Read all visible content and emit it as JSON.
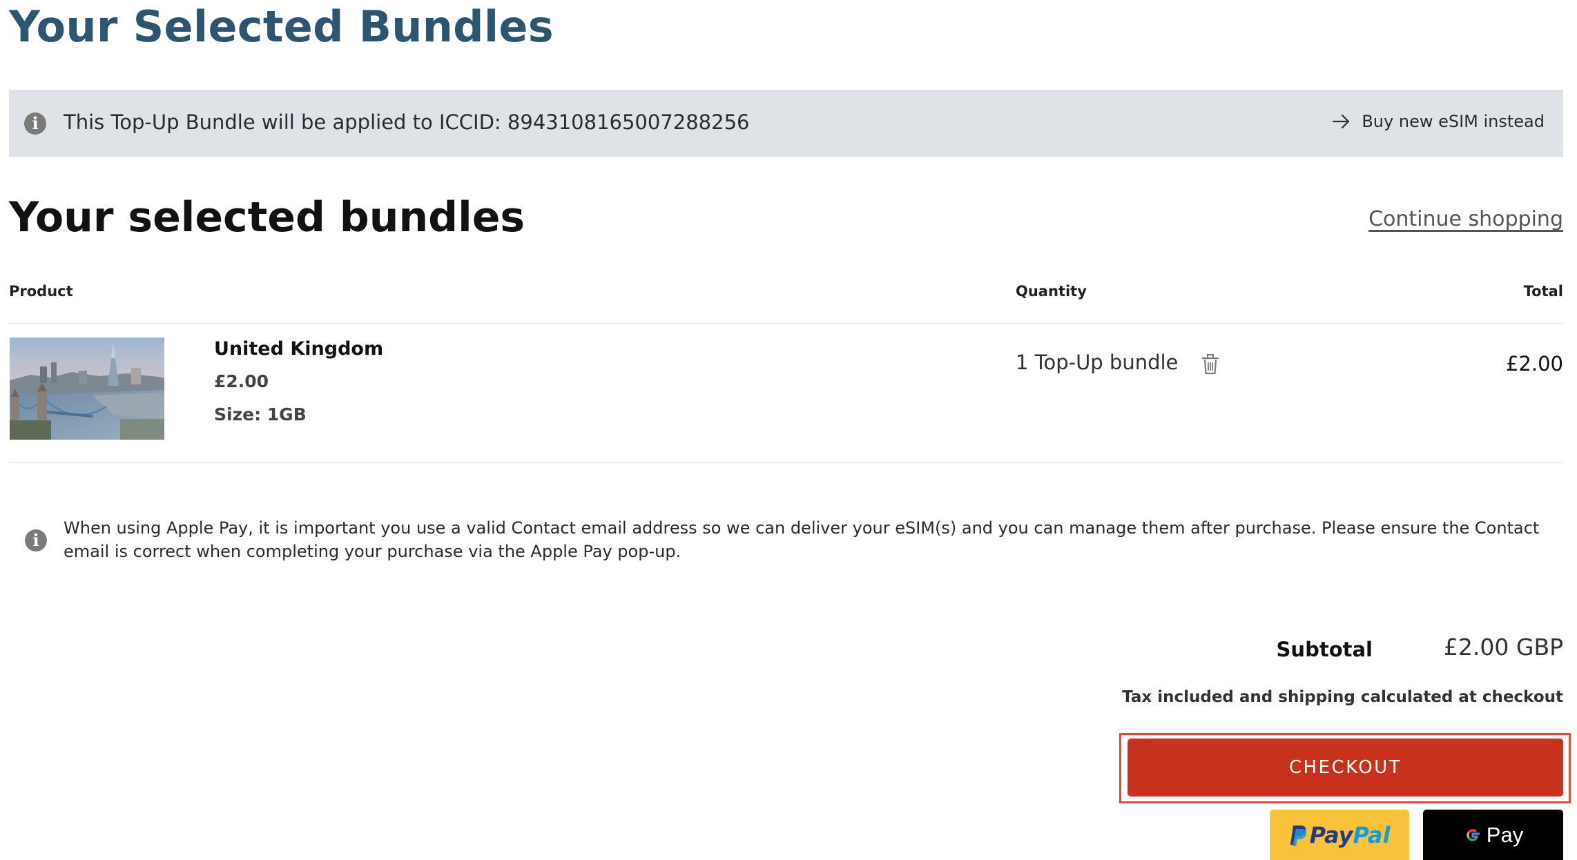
{
  "page": {
    "heading": "Your Selected Bundles"
  },
  "banner": {
    "icon": "info-icon",
    "text": "This Top-Up Bundle will be applied to ICCID: 8943108165007288256",
    "action_icon": "arrow-right-icon",
    "action_label": "Buy new eSIM instead"
  },
  "cart": {
    "title": "Your selected bundles",
    "continue_label": "Continue shopping",
    "columns": {
      "product": "Product",
      "quantity": "Quantity",
      "total": "Total"
    },
    "items": [
      {
        "image": "london-skyline-image",
        "name": "United Kingdom",
        "price": "£2.00",
        "size": "Size: 1GB",
        "quantity": "1 Top-Up bundle",
        "remove_icon": "trash-icon",
        "total": "£2.00"
      }
    ]
  },
  "notice": {
    "icon": "info-icon",
    "text": "When using Apple Pay, it is important you use a valid Contact email address so we can deliver your eSIM(s) and you can manage them after purchase. Please ensure the Contact email is correct when completing your purchase via the Apple Pay pop-up."
  },
  "summary": {
    "subtotal_label": "Subtotal",
    "subtotal_value": "£2.00 GBP",
    "tax_note": "Tax included and shipping calculated at checkout"
  },
  "actions": {
    "checkout_label": "CHECKOUT",
    "paypal_pay": "Pay",
    "paypal_pal": "Pal",
    "gpay_label": "Pay"
  },
  "colors": {
    "heading": "#2e5570",
    "banner_bg": "#dfe3e8",
    "checkout_bg": "#c8321d",
    "checkout_highlight": "#e24a33",
    "paypal_bg": "#f8c33a",
    "gpay_bg": "#000000"
  }
}
